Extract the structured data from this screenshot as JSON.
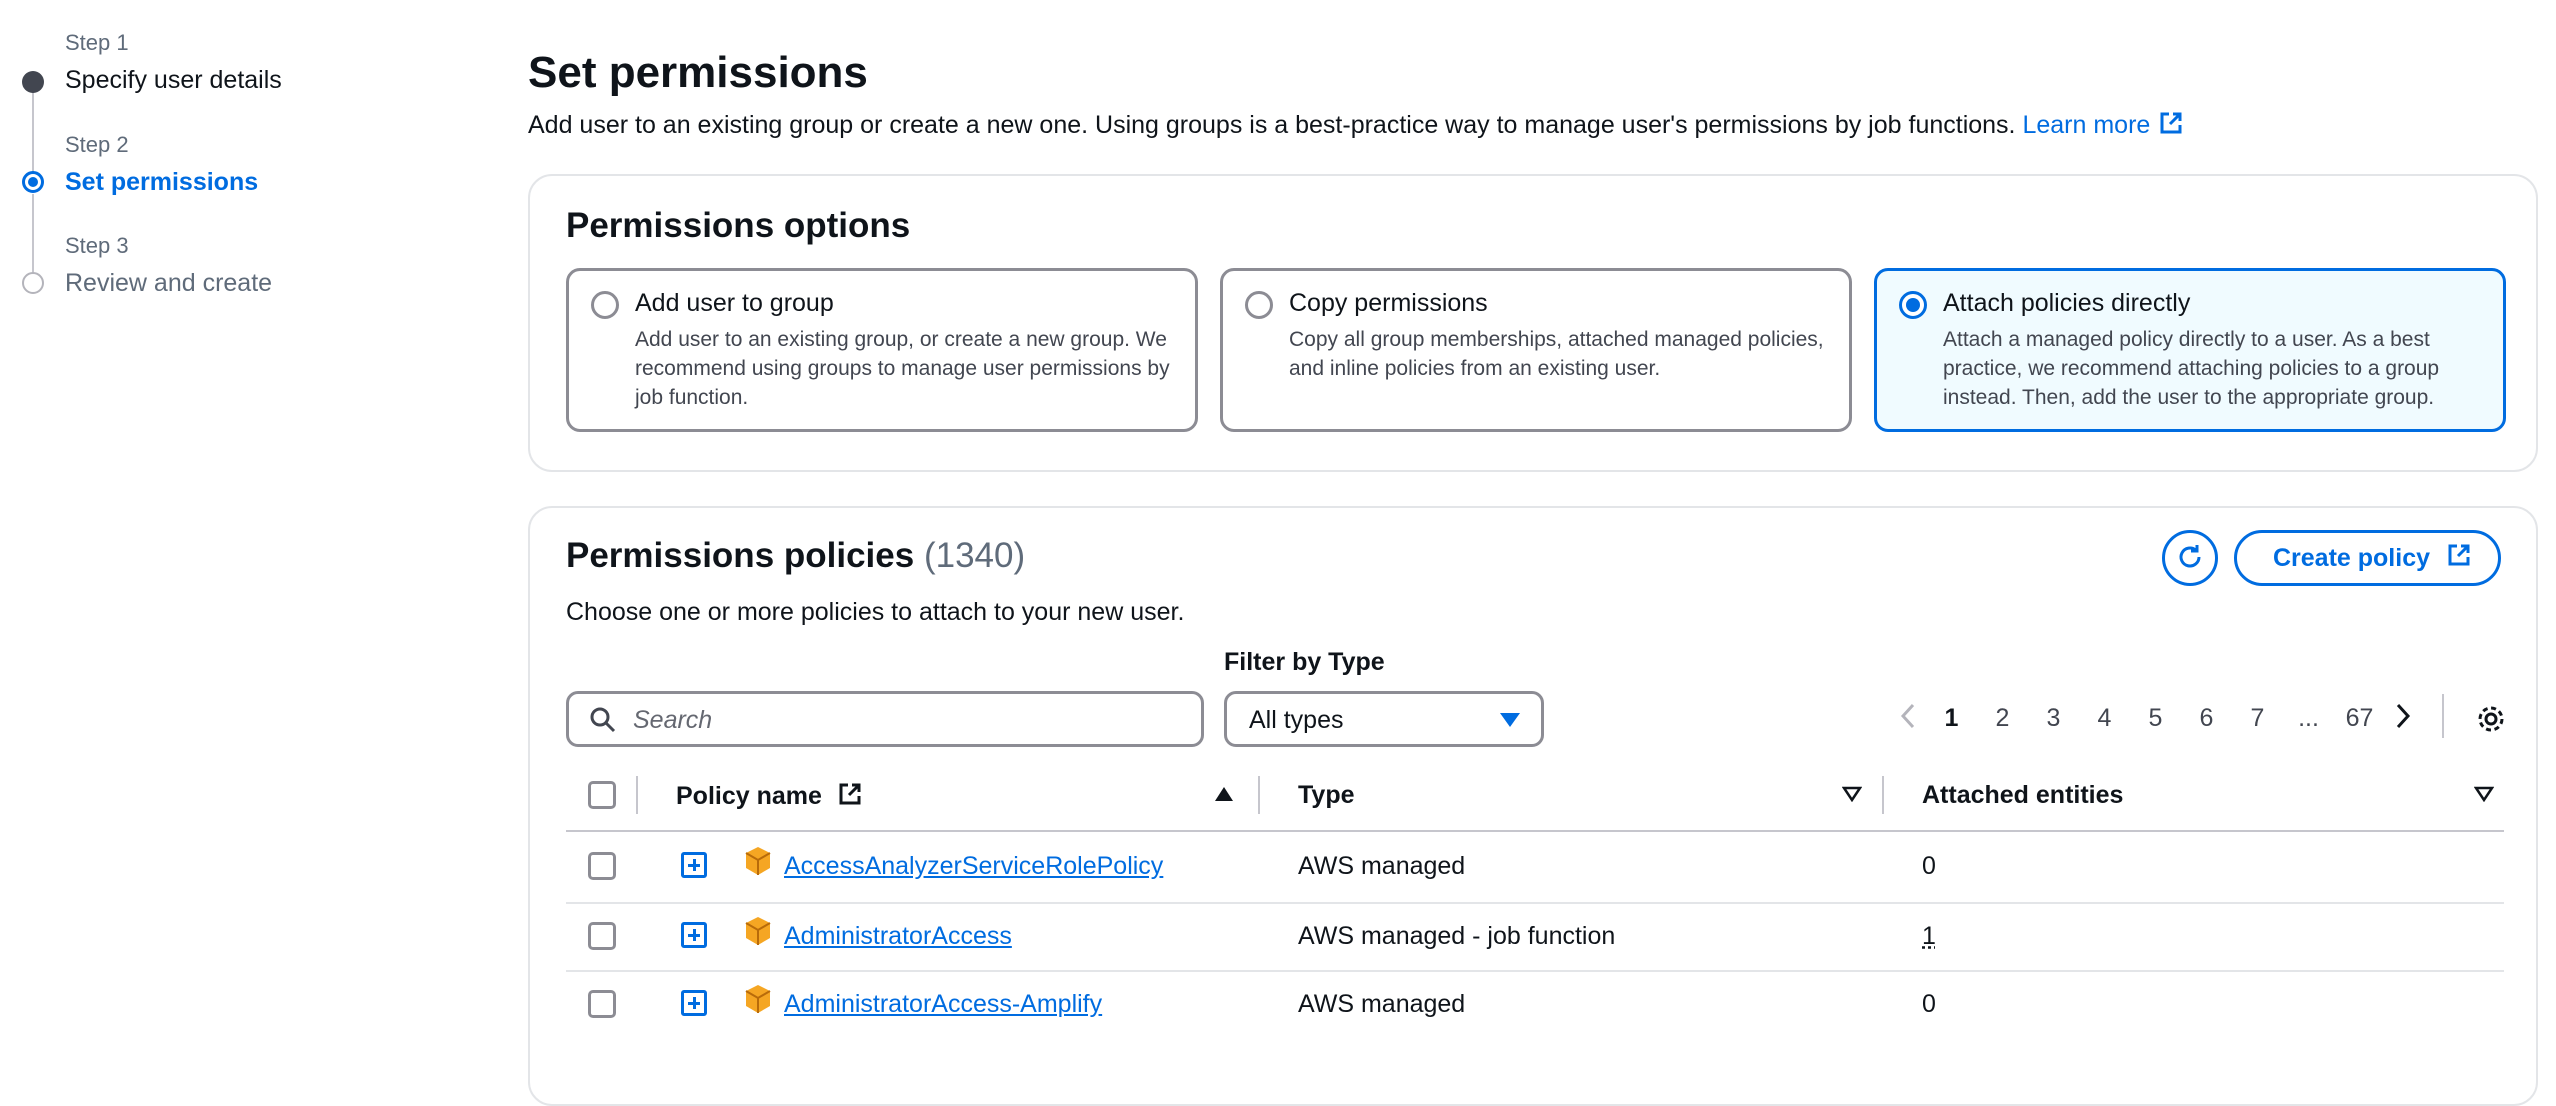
{
  "steps": [
    {
      "caption": "Step 1",
      "title": "Specify user details",
      "state": "done"
    },
    {
      "caption": "Step 2",
      "title": "Set permissions",
      "state": "current"
    },
    {
      "caption": "Step 3",
      "title": "Review and create",
      "state": "pending"
    }
  ],
  "header": {
    "title": "Set permissions",
    "description": "Add user to an existing group or create a new one. Using groups is a best-practice way to manage user's permissions by job functions.",
    "learn_more": "Learn more"
  },
  "options": {
    "title": "Permissions options",
    "tiles": [
      {
        "title": "Add user to group",
        "description": "Add user to an existing group, or create a new group. We recommend using groups to manage user permissions by job function.",
        "selected": false
      },
      {
        "title": "Copy permissions",
        "description": "Copy all group memberships, attached managed policies, and inline policies from an existing user.",
        "selected": false
      },
      {
        "title": "Attach policies directly",
        "description": "Attach a managed policy directly to a user. As a best practice, we recommend attaching policies to a group instead. Then, add the user to the appropriate group.",
        "selected": true
      }
    ]
  },
  "policies": {
    "title": "Permissions policies",
    "count": "(1340)",
    "subtitle": "Choose one or more policies to attach to your new user.",
    "create_label": "Create policy",
    "search_placeholder": "Search",
    "filter_label": "Filter by Type",
    "filter_value": "All types",
    "pages": [
      "1",
      "2",
      "3",
      "4",
      "5",
      "6",
      "7",
      "...",
      "67"
    ],
    "current_page": "1",
    "columns": {
      "name": "Policy name",
      "type": "Type",
      "entities": "Attached entities"
    },
    "rows": [
      {
        "name": "AccessAnalyzerServiceRolePolicy",
        "type": "AWS managed",
        "entities": "0"
      },
      {
        "name": "AdministratorAccess",
        "type": "AWS managed - job function",
        "entities": "1"
      },
      {
        "name": "AdministratorAccess-Amplify",
        "type": "AWS managed",
        "entities": "0"
      }
    ]
  },
  "colors": {
    "accent": "#006ce0",
    "selected_bg": "#f0fbff",
    "package_icon": "#ec9a1f"
  }
}
